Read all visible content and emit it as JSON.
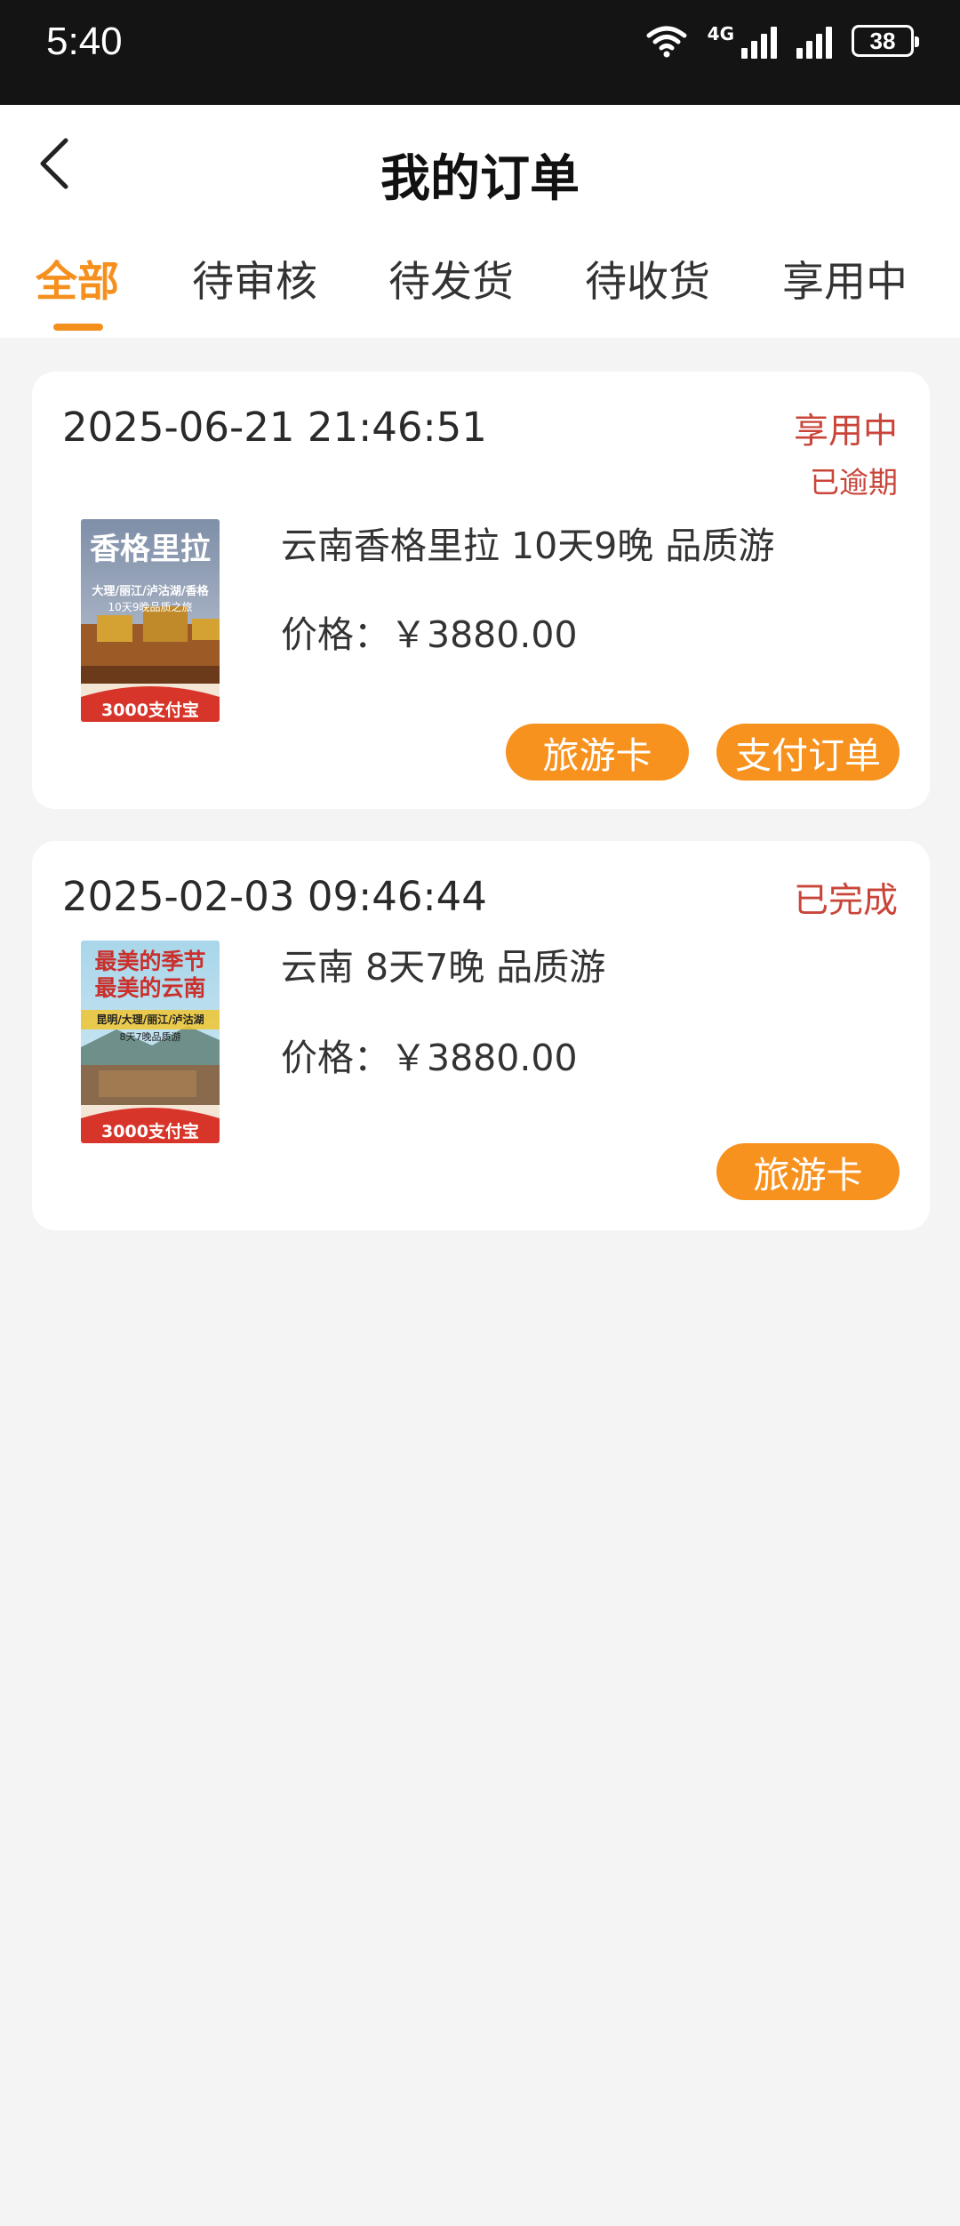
{
  "status_bar": {
    "time": "5:40",
    "network_tag": "4G",
    "battery": "38"
  },
  "header": {
    "title": "我的订单"
  },
  "tabs": [
    "全部",
    "待审核",
    "待发货",
    "待收货",
    "享用中"
  ],
  "orders": [
    {
      "time": "2025-06-21 21:46:51",
      "status": "享用中",
      "sub_status": "已逾期",
      "name": "云南香格里拉 10天9晚 品质游",
      "price": "价格：￥3880.00",
      "thumb": {
        "title": "香格里拉",
        "subtitle": "大理/丽江/泸沽湖/香格",
        "line": "10天9晚品质之旅",
        "badge": "3000支付宝"
      },
      "buttons": [
        "旅游卡",
        "支付订单"
      ]
    },
    {
      "time": "2025-02-03 09:46:44",
      "status": "已完成",
      "name": "云南 8天7晚 品质游",
      "price": "价格：￥3880.00",
      "thumb": {
        "title": "最美的季节",
        "title2": "最美的云南",
        "subtitle": "昆明/大理/丽江/泸沽湖",
        "line": "8天7晚品质游",
        "badge": "3000支付宝"
      },
      "buttons": [
        "旅游卡"
      ]
    }
  ],
  "colors": {
    "accent": "#f7921e",
    "status_red": "#c9453a",
    "background": "#f4f4f4"
  }
}
